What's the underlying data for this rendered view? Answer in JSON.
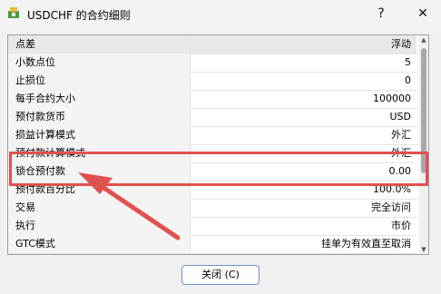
{
  "window": {
    "title": "USDCHF 的合约细则",
    "help_glyph": "?",
    "close_glyph": "✕"
  },
  "rows": [
    {
      "key": "点差",
      "value": "浮动"
    },
    {
      "key": "小数点位",
      "value": "5"
    },
    {
      "key": "止损位",
      "value": "0"
    },
    {
      "key": "每手合约大小",
      "value": "100000"
    },
    {
      "key": "预付款货币",
      "value": "USD"
    },
    {
      "key": "损益计算模式",
      "value": "外汇"
    },
    {
      "key": "预付款计算模式",
      "value": "外汇"
    },
    {
      "key": "锁仓预付款",
      "value": "0.00"
    },
    {
      "key": "预付款百分比",
      "value": "100.0%"
    },
    {
      "key": "交易",
      "value": "完全访问"
    },
    {
      "key": "执行",
      "value": "市价"
    },
    {
      "key": "GTC模式",
      "value": "挂单为有效直至取消"
    }
  ],
  "footer": {
    "close_button": "关闭 (C)"
  },
  "colors": {
    "annotation": "#e0524e",
    "button_border": "#6b95c9"
  }
}
